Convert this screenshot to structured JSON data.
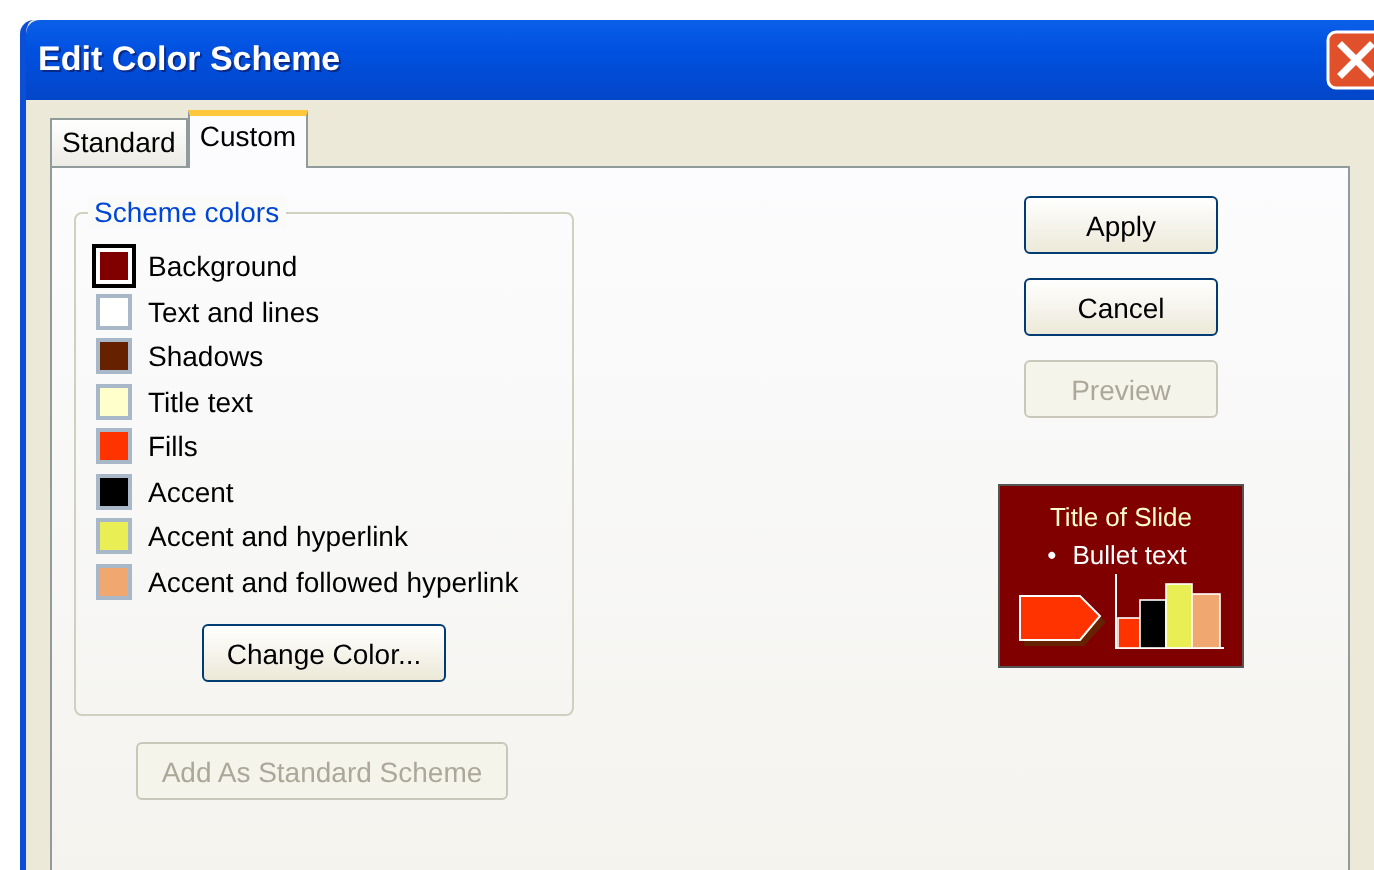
{
  "window": {
    "title": "Edit Color Scheme"
  },
  "tabs": [
    {
      "label": "Standard",
      "selected": false
    },
    {
      "label": "Custom",
      "selected": true
    }
  ],
  "scheme_colors": {
    "title": "Scheme colors",
    "items": [
      {
        "label": "Background",
        "color": "#800000",
        "selected": true
      },
      {
        "label": "Text and lines",
        "color": "#ffffff",
        "selected": false
      },
      {
        "label": "Shadows",
        "color": "#662200",
        "selected": false
      },
      {
        "label": "Title text",
        "color": "#ffffcc",
        "selected": false
      },
      {
        "label": "Fills",
        "color": "#ff3300",
        "selected": false
      },
      {
        "label": "Accent",
        "color": "#000000",
        "selected": false
      },
      {
        "label": "Accent and hyperlink",
        "color": "#eaee55",
        "selected": false
      },
      {
        "label": "Accent and followed hyperlink",
        "color": "#f0a870",
        "selected": false
      }
    ],
    "change_button": {
      "label": "Change Color...",
      "disabled": false
    }
  },
  "add_button": {
    "label": "Add As Standard Scheme",
    "disabled": true
  },
  "buttons": [
    {
      "label": "Apply",
      "disabled": false
    },
    {
      "label": "Cancel",
      "disabled": false
    },
    {
      "label": "Preview",
      "disabled": true
    }
  ],
  "preview": {
    "title": "Title of Slide",
    "bullet": "•",
    "text": "Bullet text"
  }
}
